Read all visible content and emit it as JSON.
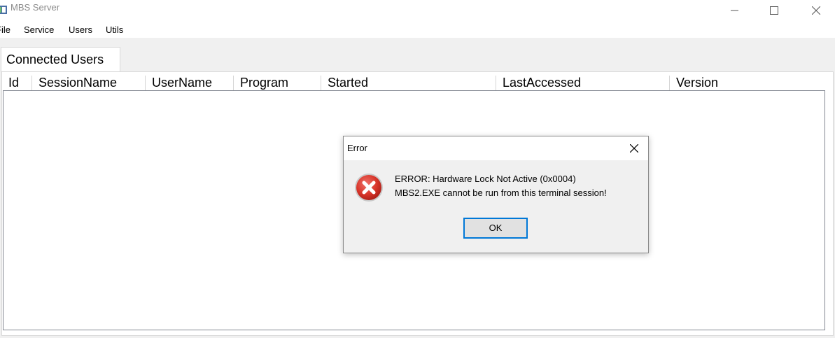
{
  "window": {
    "title": "MBS Server",
    "controls": [
      "minimize-icon",
      "maximize-icon",
      "close-icon"
    ]
  },
  "menu": {
    "items": [
      "File",
      "Service",
      "Users",
      "Utils"
    ]
  },
  "tabs": [
    {
      "label": "Connected Users",
      "selected": true
    }
  ],
  "table": {
    "columns": [
      "Id",
      "SessionName",
      "UserName",
      "Program",
      "Started",
      "LastAccessed",
      "Version"
    ],
    "rows": []
  },
  "dialog": {
    "title": "Error",
    "icon": "error-icon",
    "message_line1": "ERROR: Hardware Lock Not Active (0x0004)",
    "message_line2": "MBS2.EXE cannot be run from this terminal session!",
    "ok_label": "OK"
  },
  "colors": {
    "accent": "#0078d7",
    "error_red": "#d8352a"
  }
}
